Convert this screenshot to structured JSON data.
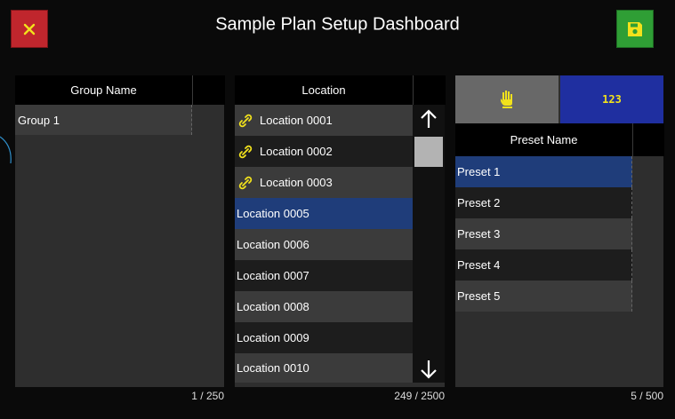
{
  "header": {
    "title": "Sample Plan Setup Dashboard"
  },
  "group_panel": {
    "column_header": "Group Name",
    "items": [
      {
        "label": "Group 1"
      }
    ],
    "counter": "1 / 250"
  },
  "location_panel": {
    "column_header": "Location",
    "items": [
      {
        "label": "Location 0001",
        "icon": "link-icon"
      },
      {
        "label": "Location 0002",
        "icon": "link-icon"
      },
      {
        "label": "Location 0003",
        "icon": "link-icon"
      },
      {
        "label": "Location 0005",
        "selected": true
      },
      {
        "label": "Location 0006"
      },
      {
        "label": "Location 0007"
      },
      {
        "label": "Location 0008"
      },
      {
        "label": "Location 0009"
      },
      {
        "label": "Location 0010"
      }
    ],
    "counter": "249 / 2500"
  },
  "preset_panel": {
    "mode_tabs": [
      {
        "icon": "hand-icon",
        "active": false
      },
      {
        "label": "123",
        "active": true
      }
    ],
    "column_header": "Preset Name",
    "items": [
      {
        "label": "Preset 1",
        "selected": true
      },
      {
        "label": "Preset 2"
      },
      {
        "label": "Preset 3"
      },
      {
        "label": "Preset 4"
      },
      {
        "label": "Preset 5"
      }
    ],
    "counter": "5 / 500"
  },
  "colors": {
    "close_button": "#c0262d",
    "save_button": "#2f9e35",
    "selection": "#1f3d7a",
    "numeric_tab": "#1f2fa0",
    "icon_yellow": "#f2e21c"
  }
}
